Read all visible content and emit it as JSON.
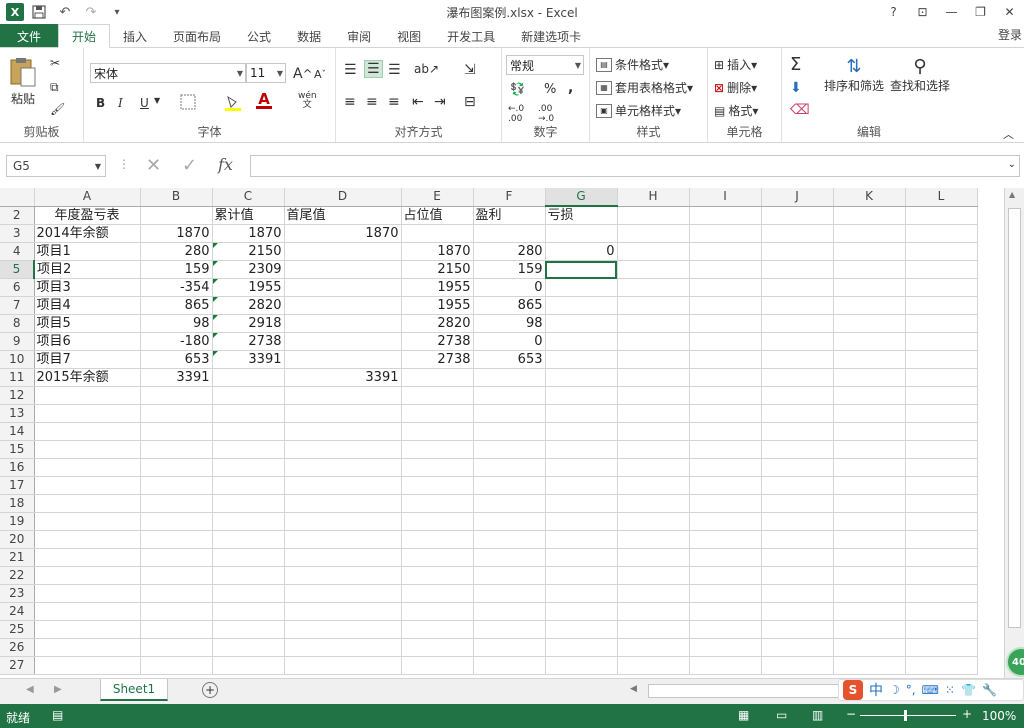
{
  "app": {
    "title": "瀑布图案例.xlsx - Excel",
    "logo": "X",
    "login": "登录",
    "accent": "#217346"
  },
  "tabs": [
    "文件",
    "开始",
    "插入",
    "页面布局",
    "公式",
    "数据",
    "审阅",
    "视图",
    "开发工具",
    "新建选项卡"
  ],
  "ribbon": {
    "clipboard": {
      "paste": "粘贴",
      "label": "剪贴板"
    },
    "font": {
      "name": "宋体",
      "size": "11",
      "label": "字体",
      "bold": "B",
      "italic": "I",
      "underline": "U",
      "grow": "A",
      "shrink": "A",
      "phonetic": "wén"
    },
    "alignment": {
      "label": "对齐方式"
    },
    "number": {
      "format": "常规",
      "label": "数字",
      "percent": "%",
      "comma": ","
    },
    "styles": {
      "conditional": "条件格式",
      "table": "套用表格格式",
      "cell": "单元格样式",
      "label": "样式"
    },
    "cells": {
      "insert": "插入",
      "delete": "删除",
      "format": "格式",
      "label": "单元格"
    },
    "editing": {
      "sort": "排序和筛选",
      "find": "查找和选择",
      "label": "编辑"
    }
  },
  "formula_bar": {
    "namebox": "G5",
    "fx": "fx",
    "value": ""
  },
  "columns": [
    "A",
    "B",
    "C",
    "D",
    "E",
    "F",
    "G",
    "H",
    "I",
    "J",
    "K",
    "L"
  ],
  "rows": [
    {
      "n": "2",
      "A": "年度盈亏表",
      "B": "",
      "C": "累计值",
      "D": "首尾值",
      "E": "占位值",
      "F": "盈利",
      "G": "亏损"
    },
    {
      "n": "3",
      "A": "2014年余额",
      "B": "1870",
      "C": "1870",
      "D": "1870",
      "E": "",
      "F": "",
      "G": ""
    },
    {
      "n": "4",
      "A": "项目1",
      "B": "280",
      "C": "2150",
      "D": "",
      "E": "1870",
      "F": "280",
      "G": "0"
    },
    {
      "n": "5",
      "A": "项目2",
      "B": "159",
      "C": "2309",
      "D": "",
      "E": "2150",
      "F": "159",
      "G": ""
    },
    {
      "n": "6",
      "A": "项目3",
      "B": "-354",
      "C": "1955",
      "D": "",
      "E": "1955",
      "F": "0",
      "G": ""
    },
    {
      "n": "7",
      "A": "项目4",
      "B": "865",
      "C": "2820",
      "D": "",
      "E": "1955",
      "F": "865",
      "G": ""
    },
    {
      "n": "8",
      "A": "项目5",
      "B": "98",
      "C": "2918",
      "D": "",
      "E": "2820",
      "F": "98",
      "G": ""
    },
    {
      "n": "9",
      "A": "项目6",
      "B": "-180",
      "C": "2738",
      "D": "",
      "E": "2738",
      "F": "0",
      "G": ""
    },
    {
      "n": "10",
      "A": "项目7",
      "B": "653",
      "C": "3391",
      "D": "",
      "E": "2738",
      "F": "653",
      "G": ""
    },
    {
      "n": "11",
      "A": "2015年余额",
      "B": "3391",
      "C": "",
      "D": "3391",
      "E": "",
      "F": "",
      "G": ""
    },
    {
      "n": "12"
    },
    {
      "n": "13"
    },
    {
      "n": "14"
    },
    {
      "n": "15"
    },
    {
      "n": "16"
    },
    {
      "n": "17"
    },
    {
      "n": "18"
    },
    {
      "n": "19"
    },
    {
      "n": "20"
    },
    {
      "n": "21"
    },
    {
      "n": "22"
    },
    {
      "n": "23"
    },
    {
      "n": "24"
    },
    {
      "n": "25"
    },
    {
      "n": "26"
    },
    {
      "n": "27"
    }
  ],
  "sheet_tab": "Sheet1",
  "status": {
    "ready": "就绪",
    "zoom": "100%"
  },
  "ime": {
    "label": "中",
    "badge": "40"
  }
}
